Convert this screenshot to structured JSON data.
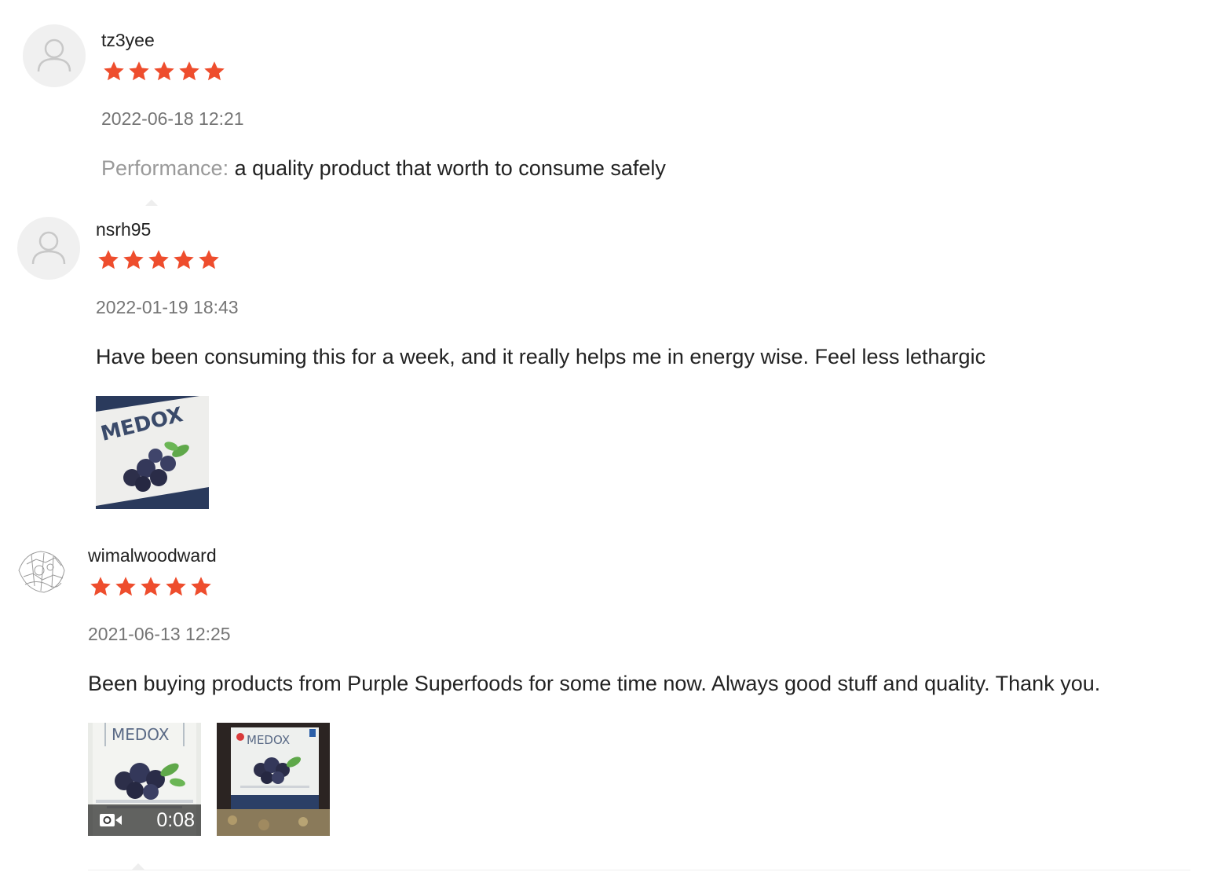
{
  "reviews": [
    {
      "username": "tz3yee",
      "rating": 5,
      "date": "2022-06-18 12:21",
      "attribute_label": "Performance:",
      "text": "a quality product that worth to consume safely",
      "avatar_icon": "default-user-icon"
    },
    {
      "username": "nsrh95",
      "rating": 5,
      "date": "2022-01-19 18:43",
      "text": "Have been consuming this for a week, and it really helps me in energy wise. Feel less lethargic",
      "avatar_icon": "default-user-icon",
      "photos": [
        {
          "brand": "MEDOX",
          "kind": "photo"
        }
      ]
    },
    {
      "username": "wimalwoodward",
      "rating": 5,
      "date": "2021-06-13 12:25",
      "text": "Been buying products from Purple Superfoods for some time now. Always good stuff and quality. Thank you.",
      "avatar_icon": "sketch-avatar",
      "photos": [
        {
          "brand": "MEDOX",
          "kind": "video",
          "duration": "0:08"
        },
        {
          "brand": "MEDOX",
          "kind": "photo"
        }
      ]
    }
  ],
  "colors": {
    "star": "#ee4d2d",
    "date": "#757575",
    "attribute_label": "#9a9a9a",
    "avatar_bg": "#f0f0f0"
  }
}
